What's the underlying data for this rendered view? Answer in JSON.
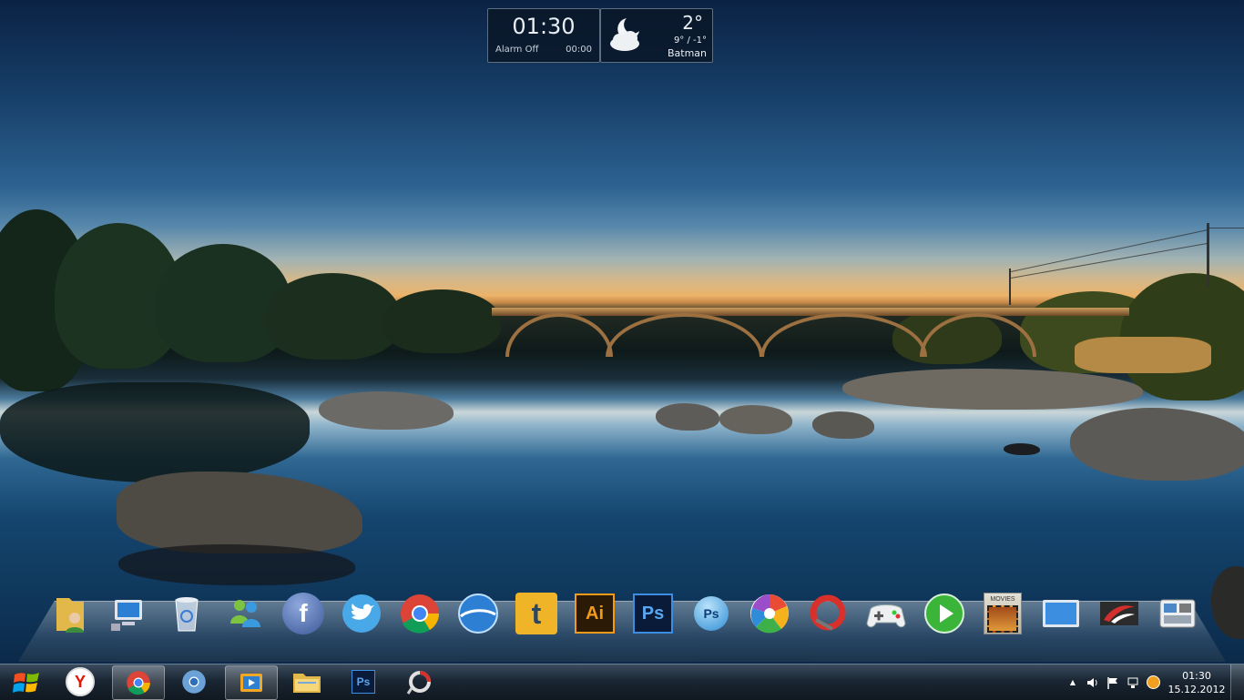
{
  "clock_gadget": {
    "time": "01:30",
    "alarm": "Alarm Off",
    "alarm_time": "00:00"
  },
  "weather_gadget": {
    "temp": "2°",
    "range": "9° / -1°",
    "location": "Batman",
    "condition_icon": "moon-cloud-icon"
  },
  "dock": {
    "items": [
      {
        "name": "user-folder",
        "icon": "user-folder-icon"
      },
      {
        "name": "computer",
        "icon": "computer-icon"
      },
      {
        "name": "recycle-bin",
        "icon": "recycle-bin-icon"
      },
      {
        "name": "messenger",
        "icon": "messenger-icon"
      },
      {
        "name": "facebook",
        "icon": "facebook-icon",
        "label": "f"
      },
      {
        "name": "twitter",
        "icon": "twitter-icon"
      },
      {
        "name": "chrome",
        "icon": "chrome-icon"
      },
      {
        "name": "google-earth",
        "icon": "google-earth-icon"
      },
      {
        "name": "tumblr",
        "icon": "tumblr-icon",
        "label": "t"
      },
      {
        "name": "illustrator",
        "icon": "illustrator-icon",
        "label": "Ai"
      },
      {
        "name": "photoshop",
        "icon": "photoshop-icon",
        "label": "Ps"
      },
      {
        "name": "photoshop-elements",
        "icon": "photoshop-elements-icon",
        "label": "Ps"
      },
      {
        "name": "picasa",
        "icon": "picasa-icon"
      },
      {
        "name": "ccleaner",
        "icon": "ccleaner-icon"
      },
      {
        "name": "gamepad",
        "icon": "gamepad-icon"
      },
      {
        "name": "media-player",
        "icon": "play-icon"
      },
      {
        "name": "movies",
        "icon": "movies-icon",
        "label": "MOVIES"
      },
      {
        "name": "display",
        "icon": "display-icon"
      },
      {
        "name": "opera-like",
        "icon": "swoosh-icon"
      },
      {
        "name": "control-panel",
        "icon": "control-panel-icon"
      }
    ]
  },
  "taskbar": {
    "start": "windows-start-icon",
    "buttons": [
      {
        "name": "yandex",
        "icon": "yandex-icon",
        "label": "Y"
      },
      {
        "name": "chrome",
        "icon": "chrome-icon",
        "active": true
      },
      {
        "name": "chromium",
        "icon": "chromium-icon"
      },
      {
        "name": "media-player",
        "icon": "media-player-icon",
        "active": true
      },
      {
        "name": "explorer",
        "icon": "folder-icon"
      },
      {
        "name": "photoshop",
        "icon": "photoshop-icon",
        "label": "Ps"
      },
      {
        "name": "app-ring",
        "icon": "ring-icon"
      }
    ],
    "tray": {
      "expand": "▲",
      "clock_time": "01:30",
      "clock_date": "15.12.2012"
    }
  }
}
